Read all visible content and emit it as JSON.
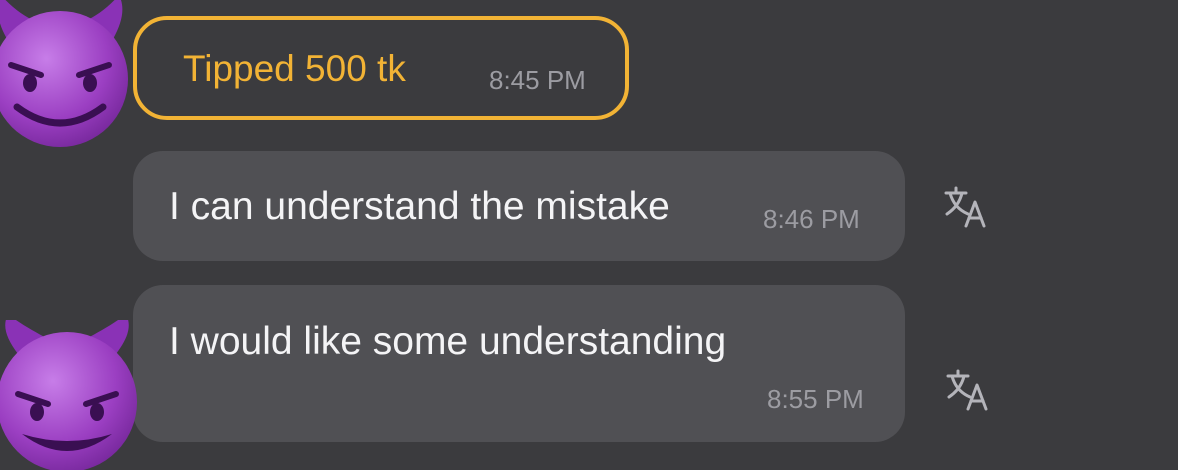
{
  "colors": {
    "background": "#3b3b3e",
    "bubble": "#505054",
    "tip_accent": "#f2b335",
    "message_text": "#f4f4f6",
    "timestamp": "#9c9ca2",
    "avatar_purple": "#9b3fc2"
  },
  "messages": [
    {
      "kind": "tip",
      "text": "Tipped 500 tk",
      "time": "8:45 PM",
      "avatar_icon": "smiling-face-with-horns-icon"
    },
    {
      "kind": "text",
      "text": "I can understand the mistake",
      "time": "8:46 PM",
      "action_icon": "translate-icon"
    },
    {
      "kind": "text",
      "text": "I would like some understanding",
      "time": "8:55 PM",
      "avatar_icon": "smiling-face-with-horns-icon",
      "action_icon": "translate-icon"
    }
  ]
}
